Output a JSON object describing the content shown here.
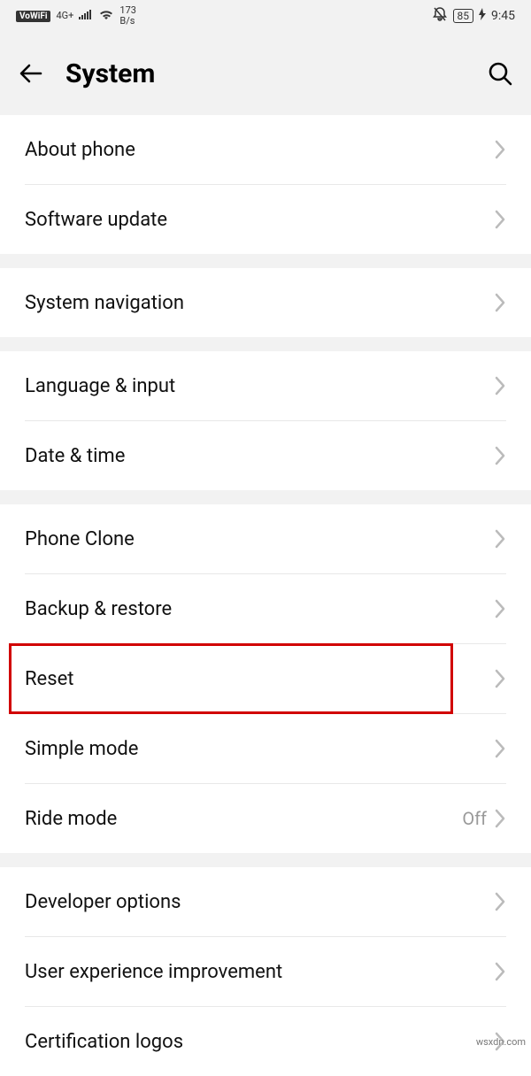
{
  "status": {
    "vowifi": "VoWiFi",
    "network_type": "4G+",
    "data_rate_value": "173",
    "data_rate_unit": "B/s",
    "battery": "85",
    "time": "9:45"
  },
  "header": {
    "title": "System"
  },
  "groups": [
    {
      "items": [
        {
          "id": "about-phone",
          "label": "About phone"
        },
        {
          "id": "software-update",
          "label": "Software update"
        }
      ]
    },
    {
      "items": [
        {
          "id": "system-navigation",
          "label": "System navigation"
        }
      ]
    },
    {
      "items": [
        {
          "id": "language-input",
          "label": "Language & input"
        },
        {
          "id": "date-time",
          "label": "Date & time"
        }
      ]
    },
    {
      "items": [
        {
          "id": "phone-clone",
          "label": "Phone Clone"
        },
        {
          "id": "backup-restore",
          "label": "Backup & restore"
        },
        {
          "id": "reset",
          "label": "Reset",
          "highlight": true
        },
        {
          "id": "simple-mode",
          "label": "Simple mode"
        },
        {
          "id": "ride-mode",
          "label": "Ride mode",
          "value": "Off"
        }
      ]
    },
    {
      "items": [
        {
          "id": "developer-options",
          "label": "Developer options"
        },
        {
          "id": "user-experience",
          "label": "User experience improvement"
        },
        {
          "id": "certification-logos",
          "label": "Certification logos"
        }
      ]
    }
  ],
  "watermark": "wsxdn.com"
}
